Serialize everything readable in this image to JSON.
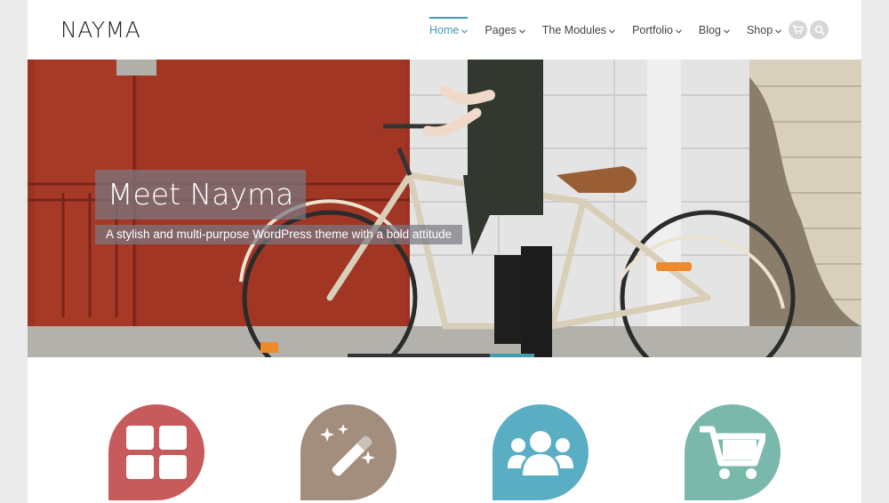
{
  "header": {
    "logo": "NAYMA",
    "nav": [
      {
        "label": "Home",
        "active": true
      },
      {
        "label": "Pages"
      },
      {
        "label": "The Modules"
      },
      {
        "label": "Portfolio"
      },
      {
        "label": "Blog"
      },
      {
        "label": "Shop"
      }
    ],
    "icons": [
      "cart-icon",
      "search-icon"
    ]
  },
  "hero": {
    "title": "Meet Nayma",
    "subtitle": "A stylish and multi-purpose WordPress theme with a bold attitude"
  },
  "features": [
    {
      "icon": "grid-icon",
      "color": "#c75b5b"
    },
    {
      "icon": "magic-wand-icon",
      "color": "#a38e7e"
    },
    {
      "icon": "users-icon",
      "color": "#5aaec4"
    },
    {
      "icon": "cart-icon",
      "color": "#7ab8ac"
    }
  ],
  "colors": {
    "accent": "#3d9fb0",
    "background": "#ebebeb"
  }
}
